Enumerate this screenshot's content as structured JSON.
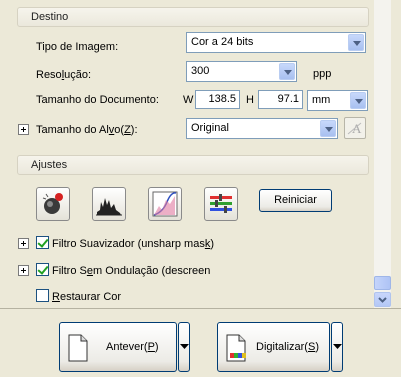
{
  "destino": {
    "title": "Destino",
    "image_type": {
      "label": "Tipo de Imagem:",
      "value": "Cor a 24 bits"
    },
    "resolution": {
      "label": "Resolução:",
      "value": "300",
      "unit": "ppp"
    },
    "doc_size": {
      "label": "Tamanho do Documento:",
      "w_label": "W",
      "w_value": "138.5",
      "h_label": "H",
      "h_value": "97.1",
      "unit": "mm"
    },
    "target_size": {
      "label": "Tamanho do Alvo(Z):",
      "value": "Original"
    }
  },
  "ajustes": {
    "title": "Ajustes",
    "reset_label": "Reiniciar",
    "options": [
      {
        "label": "Filtro Suavizador (unsharp mask)",
        "checked": true
      },
      {
        "label": "Filtro Sem Ondulação (descreen",
        "checked": true
      },
      {
        "label": "Restaurar Cor",
        "checked": false
      }
    ]
  },
  "actions": {
    "preview_label": "Antever(P)",
    "scan_label": "Digitalizar(S)"
  }
}
